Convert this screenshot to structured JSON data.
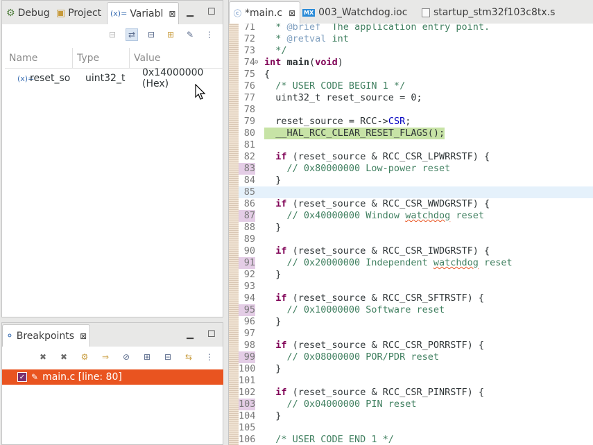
{
  "left_tabs": [
    {
      "label": "Debug",
      "icon": "debug-icon"
    },
    {
      "label": "Project",
      "icon": "project-icon"
    },
    {
      "label": "Variabl",
      "icon": "variables-icon"
    }
  ],
  "variables": {
    "columns": [
      "Name",
      "Type",
      "Value"
    ],
    "rows": [
      {
        "name": "reset_so",
        "type": "uint32_t",
        "value": "0x14000000 (Hex)"
      }
    ]
  },
  "breakpoints": {
    "tab_label": "Breakpoints",
    "items": [
      {
        "label": "main.c [line: 80]",
        "checked": true
      }
    ]
  },
  "editor": {
    "tabs": [
      {
        "label": "*main.c",
        "icon": "c-file-icon",
        "active": true
      },
      {
        "label": "003_Watchdog.ioc",
        "icon": "mx-icon",
        "active": false
      },
      {
        "label": "startup_stm32f103c8tx.s",
        "icon": "asm-file-icon",
        "active": false
      }
    ],
    "current_line": 80,
    "lines": [
      {
        "n": "71",
        "t": "  * @brief  The application entry point."
      },
      {
        "n": "72",
        "t": "  * @retval int"
      },
      {
        "n": "73",
        "t": "  */"
      },
      {
        "n": "74",
        "t": "int main(void)"
      },
      {
        "n": "75",
        "t": "{"
      },
      {
        "n": "76",
        "t": "  /* USER CODE BEGIN 1 */"
      },
      {
        "n": "77",
        "t": "  uint32_t reset_source = 0;"
      },
      {
        "n": "78",
        "t": ""
      },
      {
        "n": "79",
        "t": "  reset_source = RCC->CSR;"
      },
      {
        "n": "80",
        "t": "  __HAL_RCC_CLEAR_RESET_FLAGS();"
      },
      {
        "n": "81",
        "t": ""
      },
      {
        "n": "82",
        "t": "  if (reset_source & RCC_CSR_LPWRRSTF) {"
      },
      {
        "n": "83",
        "t": "    // 0x80000000 Low-power reset"
      },
      {
        "n": "84",
        "t": "  }"
      },
      {
        "n": "85",
        "t": ""
      },
      {
        "n": "86",
        "t": "  if (reset_source & RCC_CSR_WWDGRSTF) {"
      },
      {
        "n": "87",
        "t": "    // 0x40000000 Window watchdog reset"
      },
      {
        "n": "88",
        "t": "  }"
      },
      {
        "n": "89",
        "t": ""
      },
      {
        "n": "90",
        "t": "  if (reset_source & RCC_CSR_IWDGRSTF) {"
      },
      {
        "n": "91",
        "t": "    // 0x20000000 Independent watchdog reset"
      },
      {
        "n": "92",
        "t": "  }"
      },
      {
        "n": "93",
        "t": ""
      },
      {
        "n": "94",
        "t": "  if (reset_source & RCC_CSR_SFTRSTF) {"
      },
      {
        "n": "95",
        "t": "    // 0x10000000 Software reset"
      },
      {
        "n": "96",
        "t": "  }"
      },
      {
        "n": "97",
        "t": ""
      },
      {
        "n": "98",
        "t": "  if (reset_source & RCC_CSR_PORRSTF) {"
      },
      {
        "n": "99",
        "t": "    // 0x08000000 POR/PDR reset"
      },
      {
        "n": "100",
        "t": "  }"
      },
      {
        "n": "101",
        "t": ""
      },
      {
        "n": "102",
        "t": "  if (reset_source & RCC_CSR_PINRSTF) {"
      },
      {
        "n": "103",
        "t": "    // 0x04000000 PIN reset"
      },
      {
        "n": "104",
        "t": "  }"
      },
      {
        "n": "105",
        "t": ""
      },
      {
        "n": "106",
        "t": "  /* USER CODE END 1 */"
      }
    ]
  },
  "colors": {
    "accent": "#e95420",
    "keyword": "#7f0055",
    "comment": "#3f7f5f",
    "current_line": "#c7e3a6"
  }
}
